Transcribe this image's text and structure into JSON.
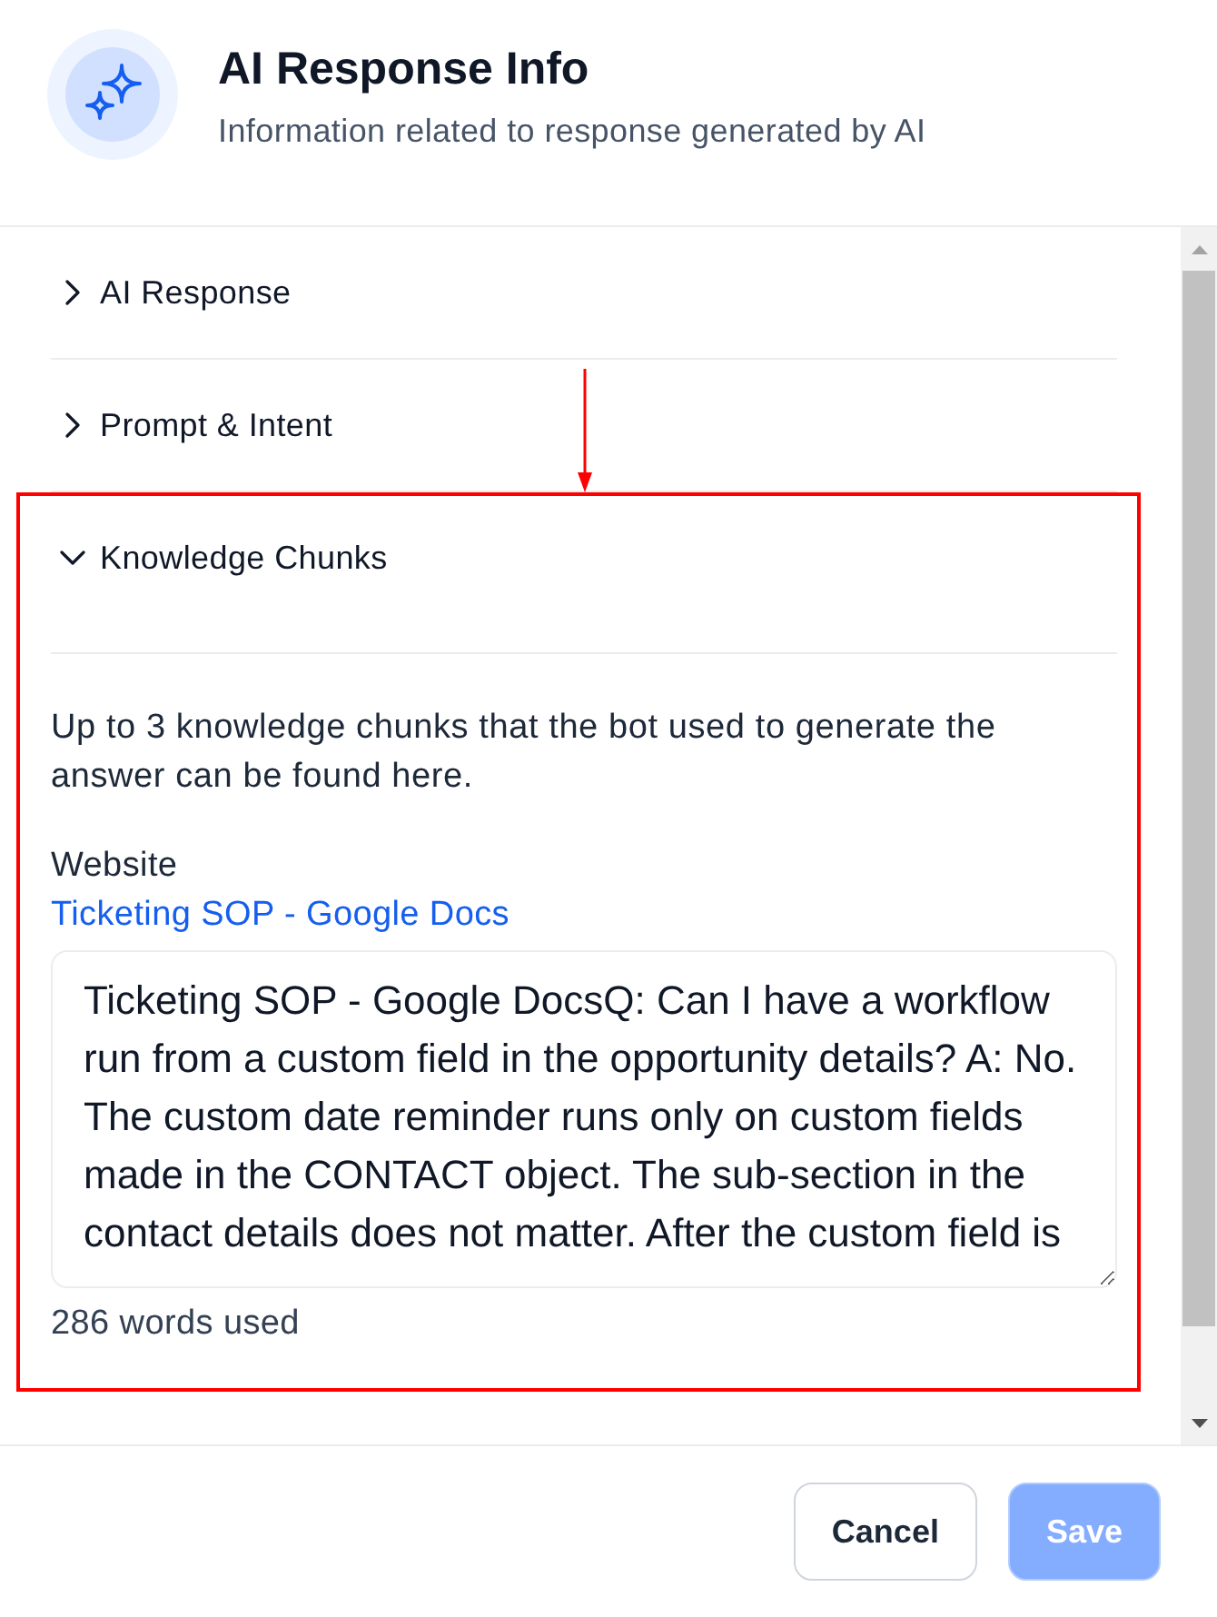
{
  "dialog": {
    "title": "AI Response Info",
    "subtitle": "Information related to response generated by AI"
  },
  "sections": [
    {
      "title": "AI Response",
      "expanded": false,
      "highlighted": false
    },
    {
      "title": "Prompt & Intent",
      "expanded": false,
      "highlighted": false
    },
    {
      "title": "Knowledge Chunks",
      "expanded": true,
      "highlighted": true,
      "description": "Up to 3 knowledge chunks that the bot used to generate the answer can be found here.",
      "chunks": [
        {
          "source_type": "Website",
          "link": "Ticketing SOP - Google Docs",
          "content": "Ticketing SOP - Google DocsQ: Can I have a workflow run from a custom field in the opportunity details? A: No. The custom date reminder runs only on custom fields made in the CONTACT object. The sub-section in the contact details does not matter. After the custom field is",
          "word_count": "286 words used"
        }
      ]
    }
  ],
  "footer": {
    "buttons": [
      {
        "label": "Cancel",
        "kind": "secondary",
        "disabled": false
      },
      {
        "label": "Save",
        "kind": "primary",
        "disabled": true
      }
    ]
  }
}
